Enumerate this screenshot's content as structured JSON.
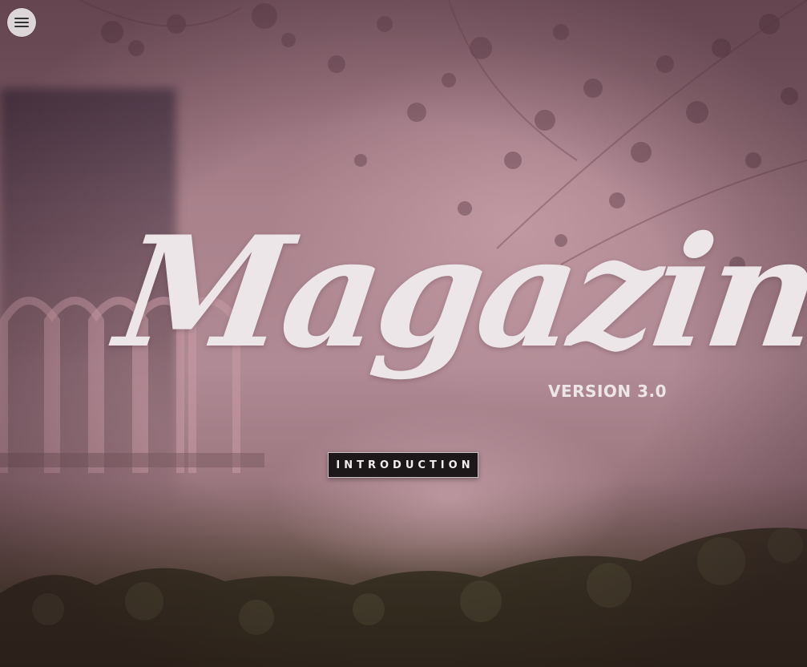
{
  "header": {
    "menu_icon": "hamburger-menu-icon"
  },
  "hero": {
    "logo_text": "Magazine",
    "version_text": "VERSION 3.0",
    "cta_label": "INTRODUCTION"
  },
  "colors": {
    "overlay_tint": "#a8818b",
    "logo_color": "#ece6e8",
    "button_bg": "#1c1819",
    "button_text": "#f2eef0",
    "menu_button_bg": "#dcd6d8"
  }
}
